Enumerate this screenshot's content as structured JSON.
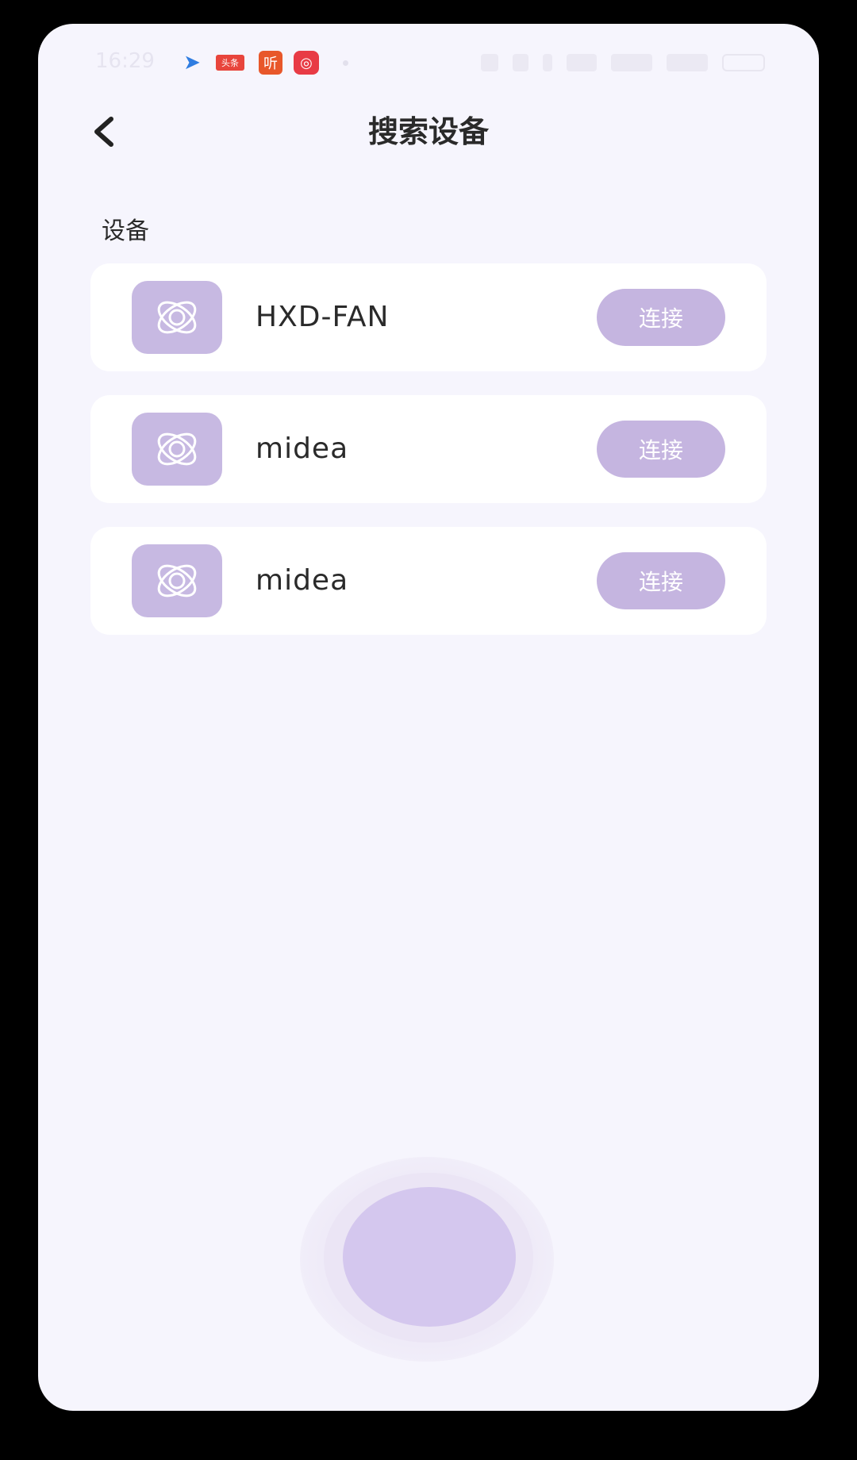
{
  "status_bar": {
    "time": "16:29",
    "app_icons": [
      {
        "icon": "play-icon",
        "glyph": "➤"
      },
      {
        "icon": "news-app-icon",
        "glyph": "头条"
      },
      {
        "icon": "listen-app-icon",
        "glyph": "听"
      },
      {
        "icon": "red-app-icon",
        "glyph": "◎"
      }
    ]
  },
  "header": {
    "title": "搜索设备"
  },
  "section": {
    "label": "设备"
  },
  "devices": [
    {
      "name": "HXD-FAN",
      "connect_label": "连接"
    },
    {
      "name": "midea",
      "connect_label": "连接"
    },
    {
      "name": "midea",
      "connect_label": "连接"
    }
  ],
  "colors": {
    "background": "#f6f5fd",
    "accent": "#c5b5e0",
    "icon_tile": "#c7b9e2",
    "search_button": "#d4c7ee"
  }
}
